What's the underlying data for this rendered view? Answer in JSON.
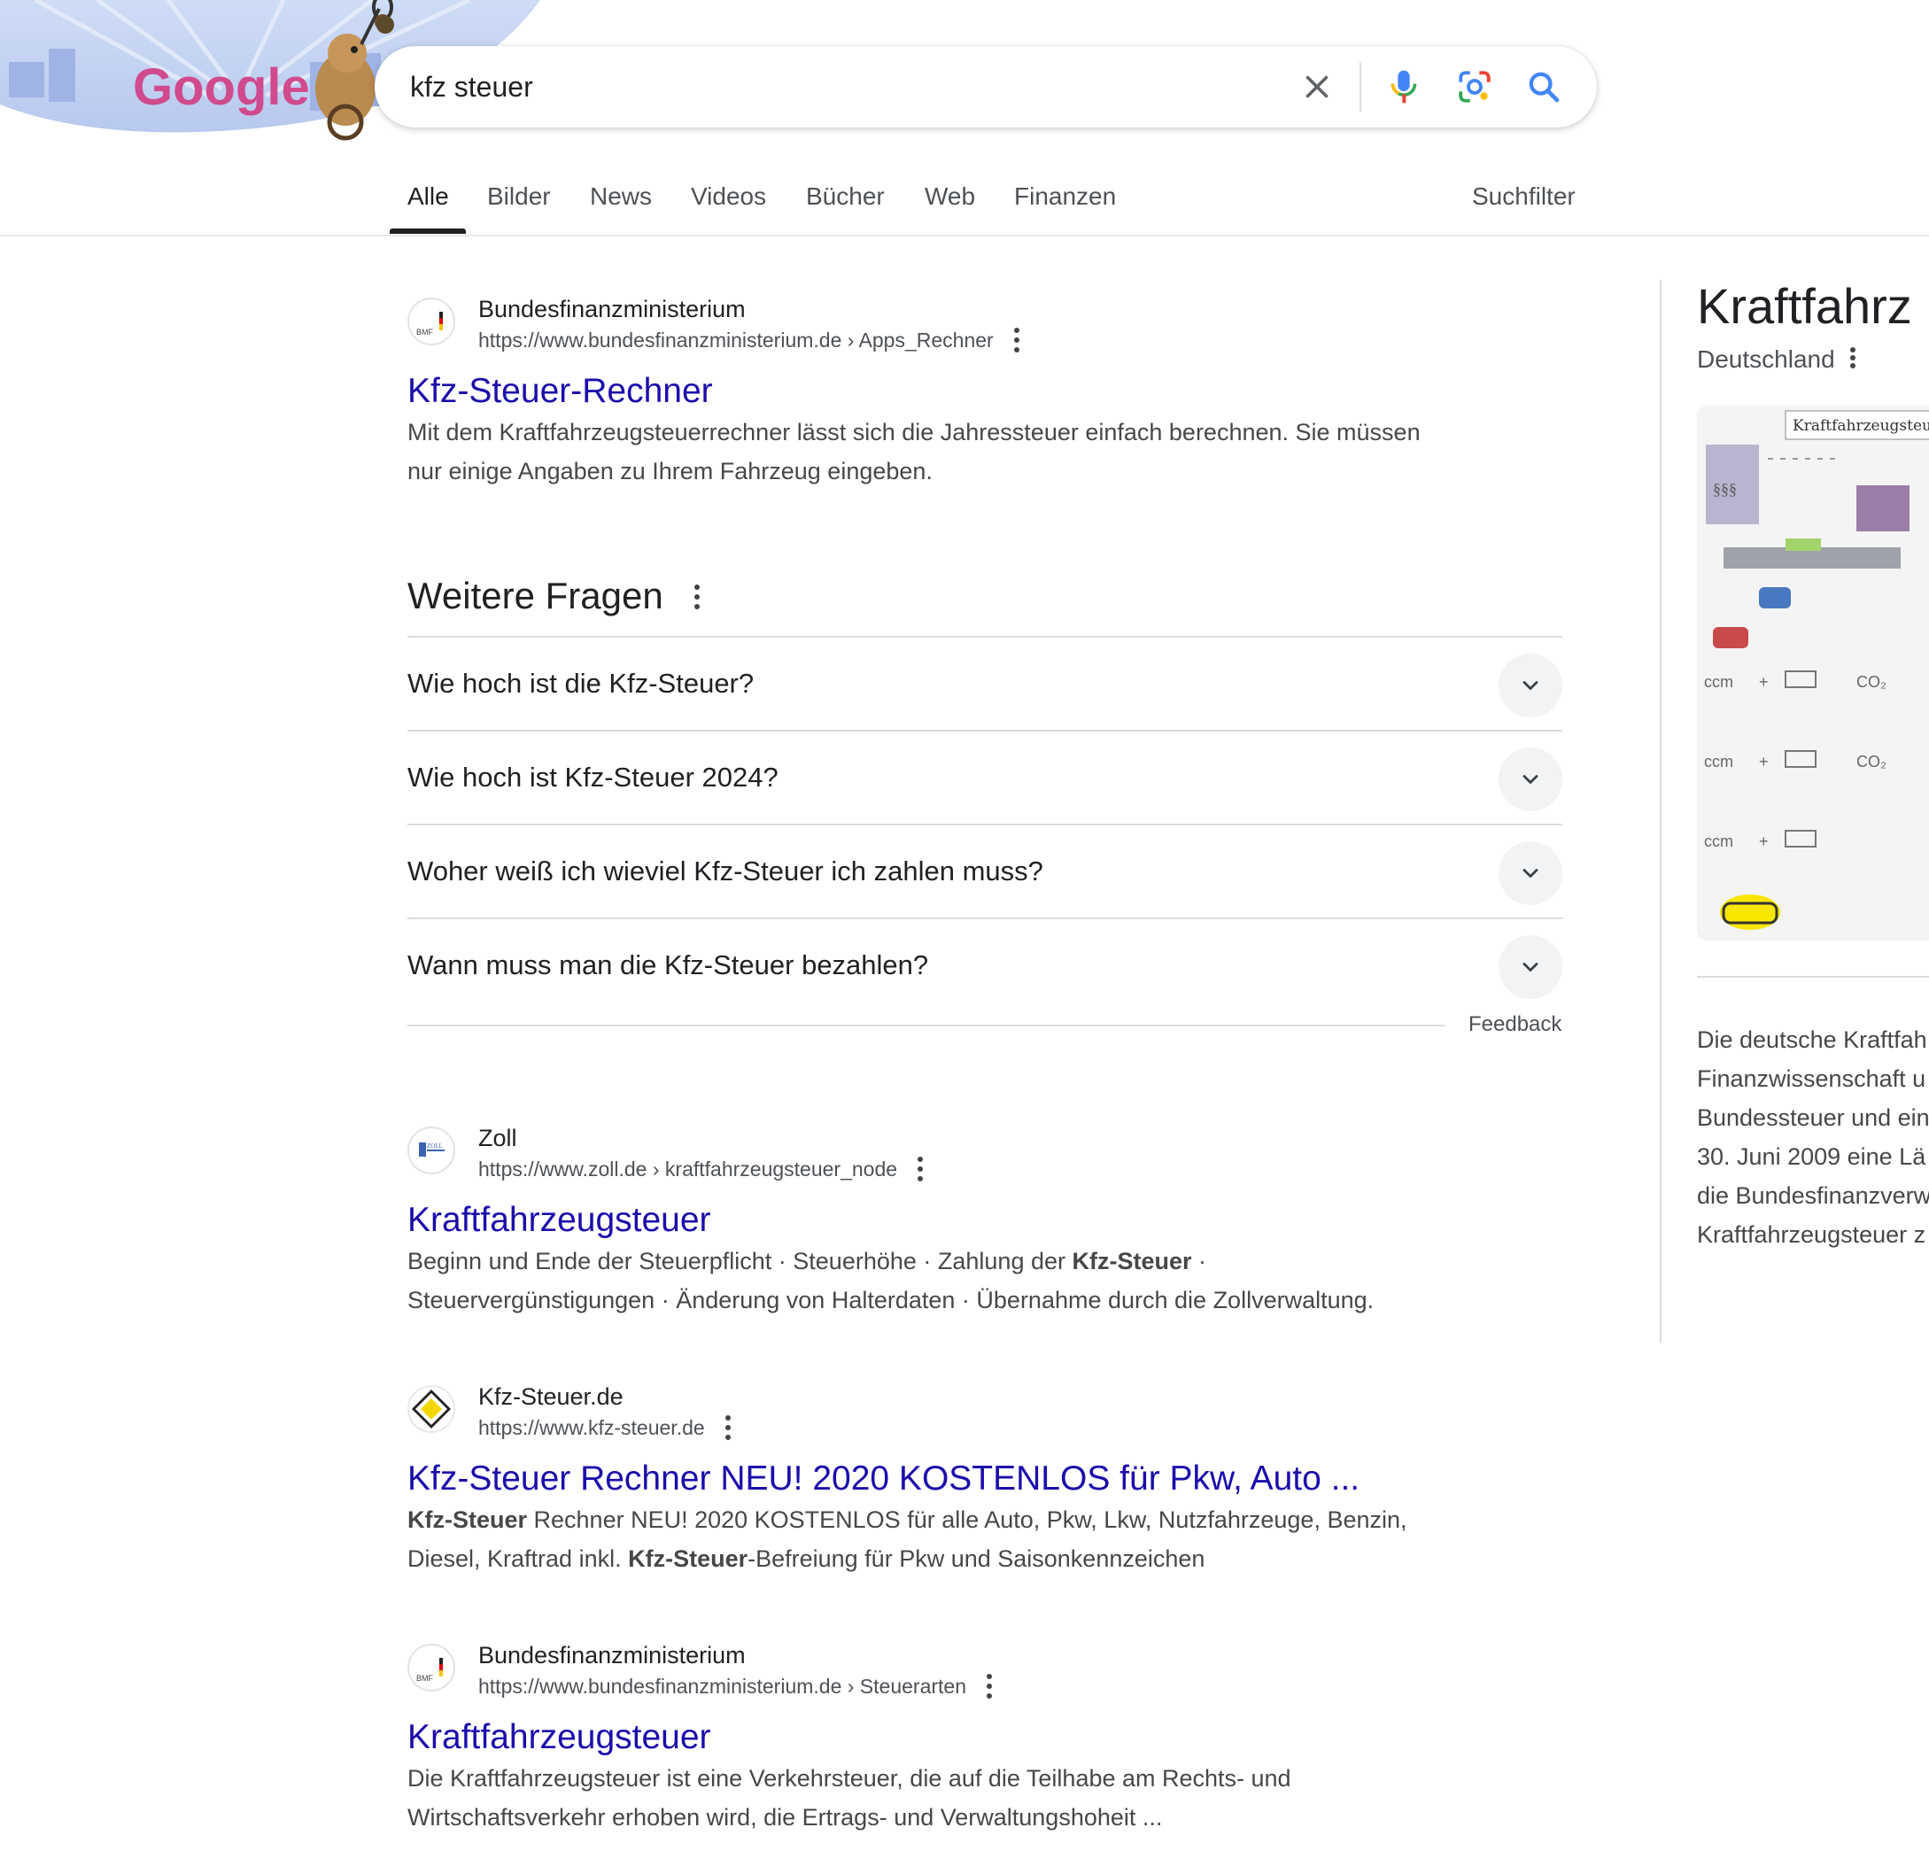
{
  "search": {
    "query": "kfz steuer",
    "doodle_text": "Google"
  },
  "tabs": [
    {
      "label": "Alle",
      "active": true
    },
    {
      "label": "Bilder"
    },
    {
      "label": "News"
    },
    {
      "label": "Videos"
    },
    {
      "label": "Bücher"
    },
    {
      "label": "Web"
    },
    {
      "label": "Finanzen"
    }
  ],
  "search_filter_label": "Suchfilter",
  "results": [
    {
      "site_name": "Bundesfinanzministerium",
      "url": "https://www.bundesfinanzministerium.de › Apps_Rechner",
      "title": "Kfz-Steuer-Rechner",
      "snippet_lines": [
        "Mit dem Kraftfahrzeugsteuerrechner lässt sich die Jahressteuer einfach berechnen. Sie müssen",
        "nur einige Angaben zu Ihrem Fahrzeug eingeben."
      ],
      "favicon": "bmf-logo-icon"
    },
    {
      "site_name": "Zoll",
      "url": "https://www.zoll.de › kraftfahrzeugsteuer_node",
      "title": "Kraftfahrzeugsteuer",
      "snippet_line1_a": "Beginn und Ende der Steuerpflicht · Steuerhöhe · Zahlung der ",
      "snippet_line1_b": "Kfz-Steuer",
      "snippet_line1_c": " ·",
      "snippet_line2": "Steuervergünstigungen · Änderung von Halterdaten · Übernahme durch die Zollverwaltung.",
      "favicon": "zoll-logo-icon"
    },
    {
      "site_name": "Kfz-Steuer.de",
      "url": "https://www.kfz-steuer.de",
      "title": "Kfz-Steuer Rechner NEU! 2020 KOSTENLOS für Pkw, Auto ...",
      "snippet_line1_a": "Kfz-Steuer",
      "snippet_line1_b": " Rechner NEU! 2020 KOSTENLOS für alle Auto, Pkw, Lkw, Nutzfahrzeuge, Benzin,",
      "snippet_line2_a": "Diesel, Kraftrad inkl. ",
      "snippet_line2_b": "Kfz-Steuer",
      "snippet_line2_c": "-Befreiung für Pkw und Saisonkennzeichen",
      "favicon": "priority-road-sign-icon"
    },
    {
      "site_name": "Bundesfinanzministerium",
      "url": "https://www.bundesfinanzministerium.de › Steuerarten",
      "title": "Kraftfahrzeugsteuer",
      "snippet_lines": [
        "Die Kraftfahrzeugsteuer ist eine Verkehrsteuer, die auf die Teilhabe am Rechts- und",
        "Wirtschaftsverkehr erhoben wird, die Ertrags- und Verwaltungshoheit ..."
      ],
      "favicon": "bmf-logo-icon"
    }
  ],
  "people_also_ask": {
    "title": "Weitere Fragen",
    "questions": [
      "Wie hoch ist die Kfz-Steuer?",
      "Wie hoch ist Kfz-Steuer 2024?",
      "Woher weiß ich wieviel Kfz-Steuer ich zahlen muss?",
      "Wann muss man die Kfz-Steuer bezahlen?"
    ],
    "feedback_label": "Feedback"
  },
  "knowledge_panel": {
    "title": "Kraftfahrz",
    "subtitle": "Deutschland",
    "image_heading": "Kraftfahrzeugsteue",
    "image_labels": [
      "§§§",
      "ccm",
      "+",
      "CO₂"
    ],
    "description_lines": [
      "Die deutsche Kraftfah",
      "Finanzwissenschaft u",
      "Bundessteuer und ein",
      "30. Juni 2009 eine Lä",
      "die Bundesfinanzverw",
      "Kraftfahrzeugsteuer z"
    ]
  },
  "colors": {
    "link": "#1a0dab",
    "text": "#202124",
    "muted": "#4d5156",
    "snippet": "#474747",
    "divider": "#dadce0",
    "mic_blue": "#4285f4",
    "mic_red": "#ea4335"
  }
}
